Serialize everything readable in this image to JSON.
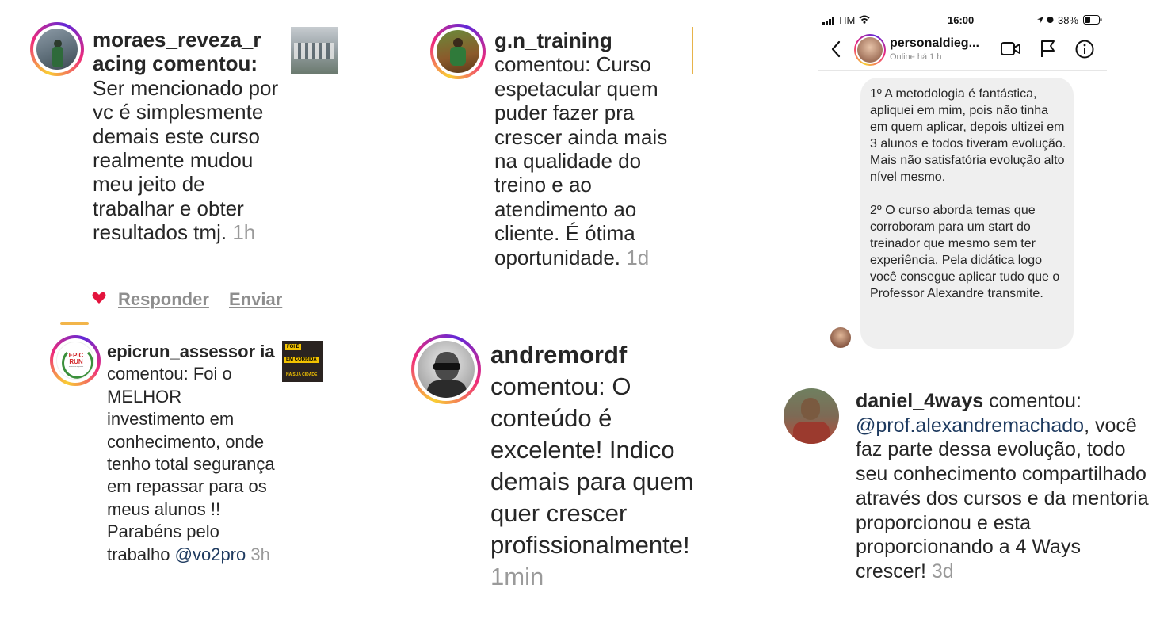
{
  "comments": [
    {
      "username": "moraes_reveza_r acing",
      "verb": "comentou:",
      "text": "Ser mencionado por vc é simplesmente demais este curso realmente mudou meu jeito de trabalhar e obter resultados tmj.",
      "time": "1h",
      "actions": {
        "reply": "Responder",
        "send": "Enviar"
      }
    },
    {
      "username": "g.n_training",
      "verb": "comentou:",
      "text": "Curso espetacular quem puder fazer pra crescer ainda mais na qualidade do treino e ao atendimento ao cliente. É ótima oportunidade.",
      "time": "1d"
    },
    {
      "username": "epicrun_assessor ia",
      "verb": "comentou:",
      "text": "Foi o MELHOR investimento em conhecimento, onde tenho total segurança em repassar para os meus alunos !! Parabéns pelo trabalho",
      "mention": "@vo2pro",
      "time": "3h",
      "logo_text": "EPIC RUN",
      "logo_subtext": "assessoria esportiva",
      "thumb_text": [
        "FOI É",
        "EM CORRIDA",
        "NA SUA CIDADE"
      ]
    },
    {
      "username": "andremordf",
      "verb": "comentou:",
      "text": "O conteúdo é excelente! Indico demais para quem quer crescer profissionalmente!",
      "time": "1min"
    },
    {
      "username": "daniel_4ways",
      "verb": "comentou:",
      "mention": "@prof.alexandremachado",
      "text": ", você faz parte dessa evolução, todo seu conhecimento compartilhado através dos cursos e da mentoria proporcionou e esta proporcionando a 4 Ways crescer!",
      "time": "3d"
    }
  ],
  "dm": {
    "status": {
      "carrier": "TIM",
      "time": "16:00",
      "battery": "38%"
    },
    "contact": {
      "name": "personaldieg...",
      "status": "Online há 1 h"
    },
    "message_1": "1º A metodologia é fantástica, apliquei em mim, pois não tinha em quem aplicar, depois ultizei em 3 alunos e todos tiveram evolução. Mais não satisfatória evolução alto nível mesmo.",
    "message_2": "2º O curso aborda temas que corroboram para um start do treinador que mesmo sem ter experiência. Pela didática logo você consegue aplicar tudo que o Professor Alexandre transmite.",
    "icons": [
      "back-chevron-icon",
      "video-call-icon",
      "flag-icon",
      "info-icon"
    ]
  },
  "colors": {
    "time": "#9a9a9a",
    "mention": "#1e3a5f",
    "heart": "#e3143d",
    "bubble": "#efefef"
  }
}
